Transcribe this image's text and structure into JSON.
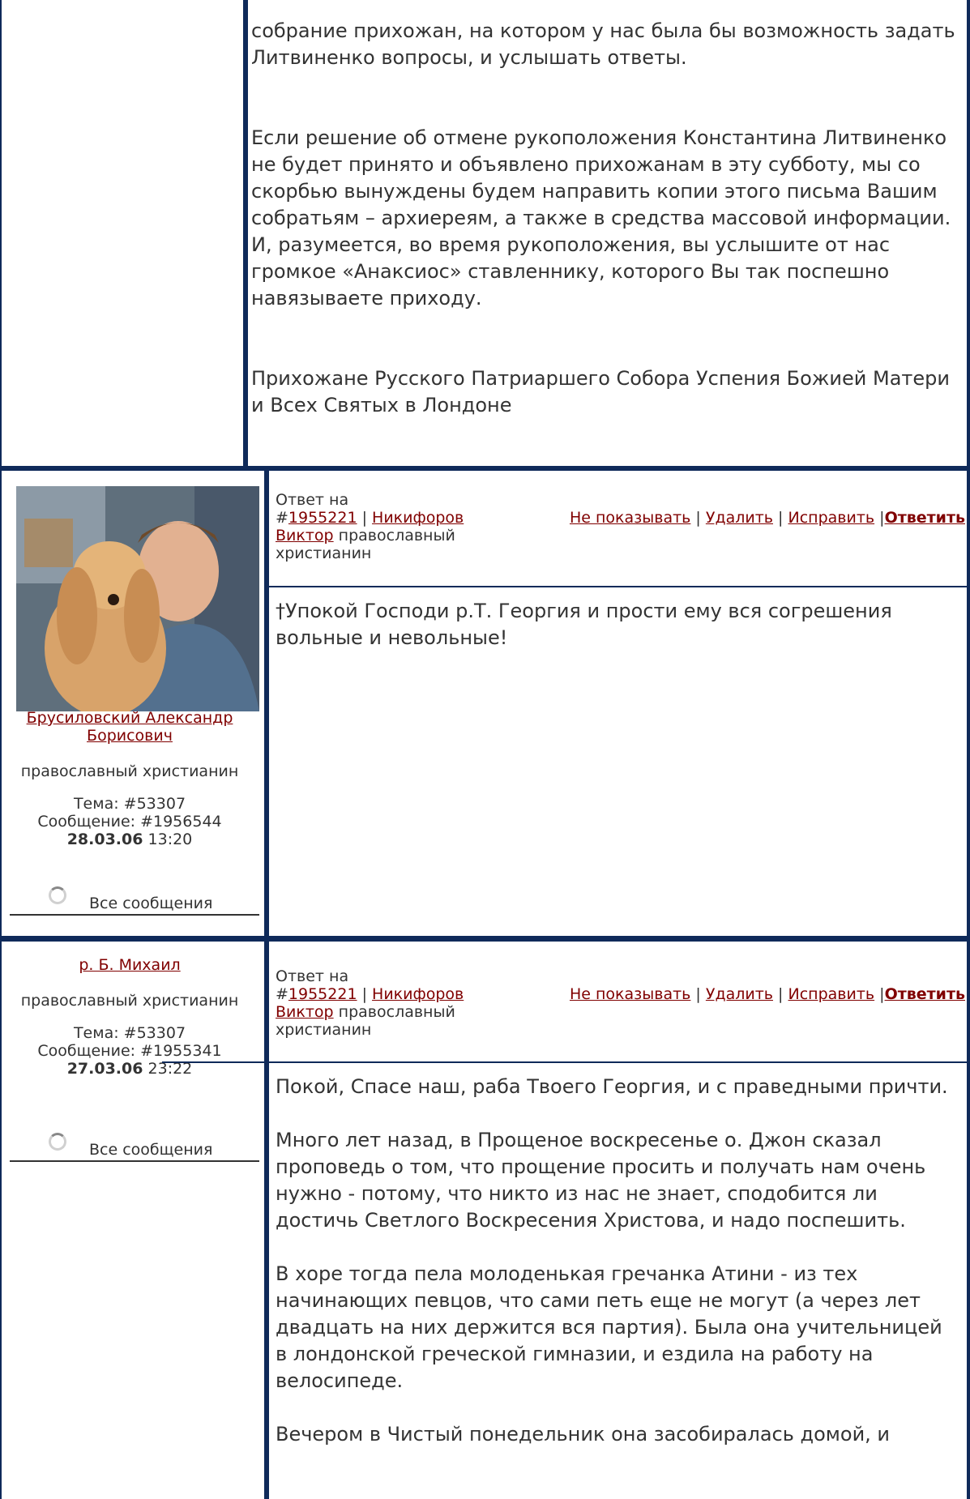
{
  "post0": {
    "paragraphs": [
      "собрание прихожан, на котором у нас была бы возможность задать Литвиненко вопросы, и услышать ответы.",
      "Если решение об отмене рукоположения Константина Литвиненко не будет принято и объявлено прихожанам в эту субботу, мы со скорбью вынуждены будем направить копии этого письма Вашим собратьям – архиереям, а также в средства массовой информации. И, разумеется, во время рукоположения, вы услышите от нас громкое «Анаксиос» ставленнику, которого Вы так поспешно навязываете приходу.",
      "Прихожане Русского Патриаршего Собора Успения Божией Матери и Всех Святых в Лондоне"
    ]
  },
  "post1": {
    "author_name": "Брусиловский Александр Борисович",
    "author_status": "православный христианин",
    "topic": "Тема: #53307",
    "message": "Сообщение: #1956544",
    "date": "28.03.06",
    "time": "13:20",
    "all_messages": "Все сообщения",
    "reply_prefix": "Ответ на",
    "reply_hash": "#",
    "reply_id": "1955221",
    "reply_author": "Никифоров Виктор",
    "reply_author_status": "православный христианин",
    "actions": {
      "hide": "Не показывать",
      "delete": "Удалить",
      "edit": "Исправить",
      "reply": "Ответить"
    },
    "body": "†Упокой Господи р.Т. Георгия и прости ему вся согрешения вольные и невольные!"
  },
  "post2": {
    "author_name": "р. Б. Михаил",
    "author_status": "православный христианин",
    "topic": "Тема: #53307",
    "message": "Сообщение: #1955341",
    "date": "27.03.06",
    "time": "23:22",
    "all_messages": "Все сообщения",
    "reply_prefix": "Ответ на",
    "reply_hash": "#",
    "reply_id": "1955221",
    "reply_author": "Никифоров Виктор",
    "reply_author_status": "православный христианин",
    "actions": {
      "hide": "Не показывать",
      "delete": "Удалить",
      "edit": "Исправить",
      "reply": "Ответить"
    },
    "paragraphs": [
      "Покой, Спасе наш, раба Твоего Георгия, и с праведными причти.",
      "Много лет назад, в Прощеное воскресенье о. Джон сказал проповедь о том, что прощение просить и получать нам очень нужно - потому, что никто из нас не знает, сподобится ли достичь Светлого Воскресения Христова, и надо поспешить.",
      "В хоре тогда пела молоденькая гречанка Атини - из тех начинающих певцов, что сами петь еще не могут (а через лет двадцать на них держится вся партия). Была она учительницей в лондонской греческой гимназии, и ездила на работу на велосипеде.",
      "Вечером в Чистый понедельник она засобиралась домой, и"
    ]
  },
  "colors": {
    "border": "#0f2a5a",
    "link": "#800000",
    "text": "#333333"
  }
}
